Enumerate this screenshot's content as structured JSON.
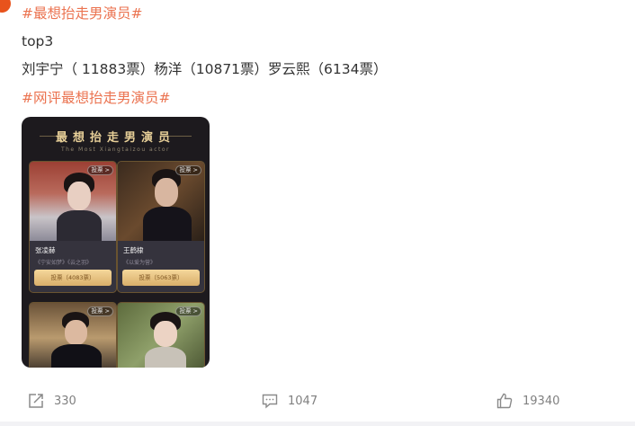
{
  "post": {
    "topic1": "#最想抬走男演员#",
    "line2": "top3",
    "line3": "刘宇宁（ 11883票）杨洋（10871票）罗云熙（6134票）",
    "topic2": "#网评最想抬走男演员#"
  },
  "card": {
    "title": "最想抬走男演员",
    "subtitle": "The Most Xiangtaizou actor",
    "tiles": [
      {
        "badge": "投票 >",
        "name": "张凌赫",
        "works": "《宁安如梦》《云之羽》",
        "button": "投票（4083票）"
      },
      {
        "badge": "投票 >",
        "name": "王鹤棣",
        "works": "《以爱为营》",
        "button": "投票（5063票）"
      },
      {
        "badge": "投票 >"
      },
      {
        "badge": "投票 >"
      }
    ]
  },
  "actions": {
    "share_count": "330",
    "comment_count": "1047",
    "like_count": "19340"
  }
}
